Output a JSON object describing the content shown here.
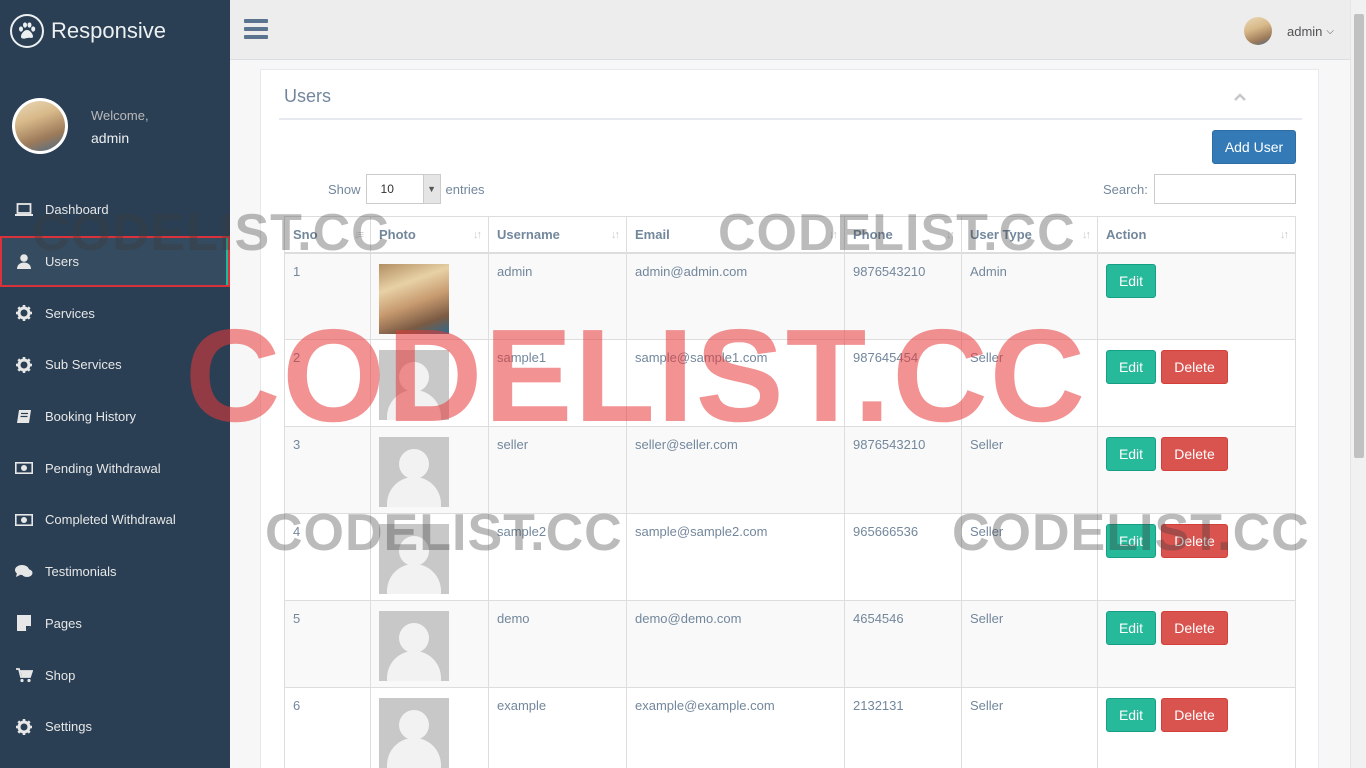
{
  "brand": {
    "name": "Responsive",
    "icon": "paw-icon"
  },
  "profile": {
    "welcome": "Welcome,",
    "name": "admin"
  },
  "menu": [
    {
      "label": "Dashboard",
      "icon": "laptop-icon"
    },
    {
      "label": "Users",
      "icon": "user-icon",
      "active": true
    },
    {
      "label": "Services",
      "icon": "gear-icon"
    },
    {
      "label": "Sub Services",
      "icon": "gear-icon"
    },
    {
      "label": "Booking History",
      "icon": "book-icon"
    },
    {
      "label": "Pending Withdrawal",
      "icon": "money-icon"
    },
    {
      "label": "Completed Withdrawal",
      "icon": "money-icon"
    },
    {
      "label": "Testimonials",
      "icon": "comments-icon"
    },
    {
      "label": "Pages",
      "icon": "file-icon"
    },
    {
      "label": "Shop",
      "icon": "cart-icon"
    },
    {
      "label": "Settings",
      "icon": "gear-icon"
    }
  ],
  "topnav": {
    "username": "admin"
  },
  "panel": {
    "title": "Users",
    "add_user_label": "Add User",
    "show_label": "Show",
    "entries_value": "10",
    "entries_label": "entries",
    "search_label": "Search:",
    "search_value": ""
  },
  "table": {
    "headers": [
      "Sno",
      "Photo",
      "Username",
      "Email",
      "Phone",
      "User Type",
      "Action"
    ],
    "edit_label": "Edit",
    "delete_label": "Delete",
    "rows": [
      {
        "sno": "1",
        "username": "admin",
        "email": "admin@admin.com",
        "phone": "9876543210",
        "type": "Admin",
        "photo": "real",
        "deletable": false
      },
      {
        "sno": "2",
        "username": "sample1",
        "email": "sample@sample1.com",
        "phone": "987645454",
        "type": "Seller",
        "photo": "placeholder",
        "deletable": true
      },
      {
        "sno": "3",
        "username": "seller",
        "email": "seller@seller.com",
        "phone": "9876543210",
        "type": "Seller",
        "photo": "placeholder",
        "deletable": true
      },
      {
        "sno": "4",
        "username": "sample2",
        "email": "sample@sample2.com",
        "phone": "965666536",
        "type": "Seller",
        "photo": "placeholder",
        "deletable": true
      },
      {
        "sno": "5",
        "username": "demo",
        "email": "demo@demo.com",
        "phone": "4654546",
        "type": "Seller",
        "photo": "placeholder",
        "deletable": true
      },
      {
        "sno": "6",
        "username": "example",
        "email": "example@example.com",
        "phone": "2132131",
        "type": "Seller",
        "photo": "placeholder",
        "deletable": true
      }
    ]
  },
  "watermark": {
    "text": "CODELIST.CC"
  },
  "colors": {
    "sidebar": "#2a3f54",
    "accent": "#1abb9c",
    "primary": "#337ab7",
    "success": "#26b99a",
    "danger": "#d9534f"
  }
}
